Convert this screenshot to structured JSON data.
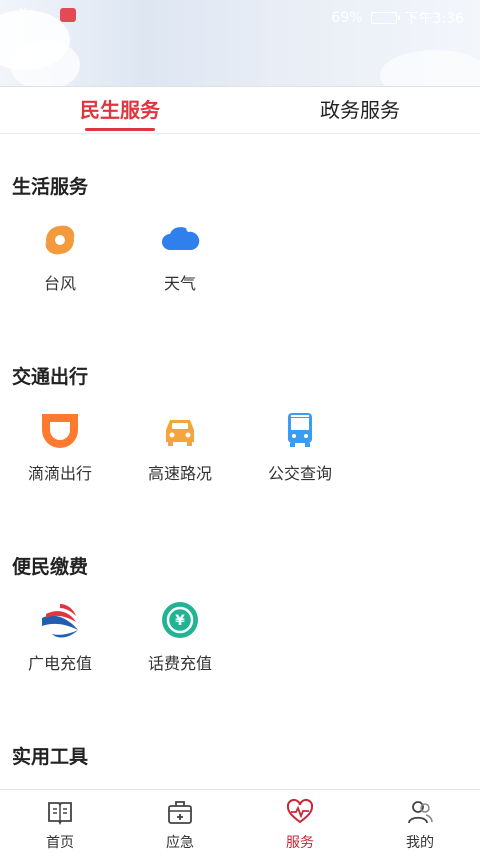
{
  "statusbar": {
    "battery": "69%",
    "time": "下午3:36"
  },
  "tabs": [
    {
      "label": "民生服务",
      "active": true
    },
    {
      "label": "政务服务",
      "active": false
    }
  ],
  "sections": [
    {
      "title": "生活服务",
      "items": [
        {
          "label": "台风",
          "icon": "typhoon-icon"
        },
        {
          "label": "天气",
          "icon": "weather-cloud-icon"
        }
      ]
    },
    {
      "title": "交通出行",
      "items": [
        {
          "label": "滴滴出行",
          "icon": "didi-icon"
        },
        {
          "label": "高速路况",
          "icon": "car-icon"
        },
        {
          "label": "公交查询",
          "icon": "bus-icon"
        }
      ]
    },
    {
      "title": "便民缴费",
      "items": [
        {
          "label": "广电充值",
          "icon": "broadcast-logo-icon"
        },
        {
          "label": "话费充值",
          "icon": "yuan-recharge-icon"
        }
      ]
    },
    {
      "title": "实用工具",
      "items": []
    }
  ],
  "bottom_nav": [
    {
      "label": "首页",
      "icon": "book-icon",
      "active": false
    },
    {
      "label": "应急",
      "icon": "first-aid-kit-icon",
      "active": false
    },
    {
      "label": "服务",
      "icon": "heart-pulse-icon",
      "active": true
    },
    {
      "label": "我的",
      "icon": "user-icon",
      "active": false
    }
  ],
  "colors": {
    "accent": "#e0353f",
    "typhoon": "#f39a3c",
    "weather": "#2f80ed",
    "didi": "#ff7a2f",
    "car": "#f6a53c",
    "bus": "#3a9cf2",
    "yuan": "#20b394"
  }
}
